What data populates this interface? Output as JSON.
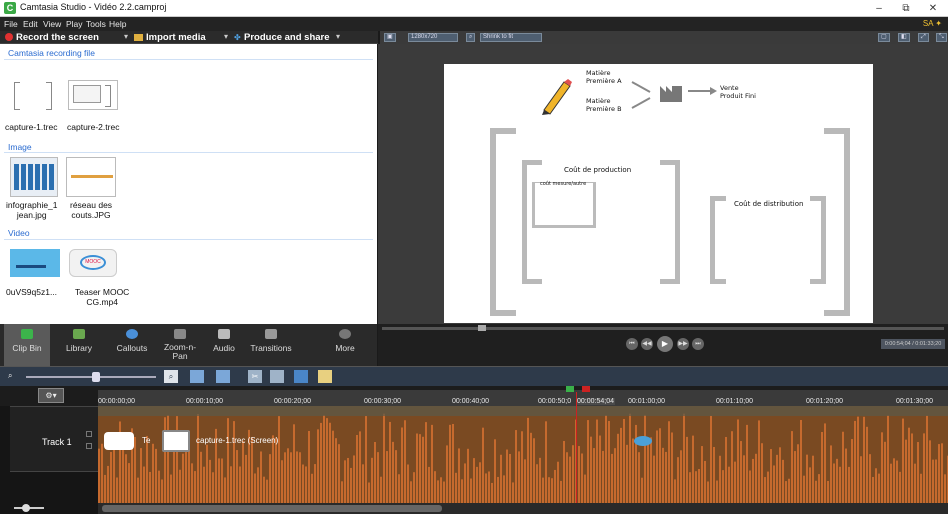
{
  "window": {
    "title": "Camtasia Studio - Vidéo 2.2.camproj",
    "app_icon": "C"
  },
  "menu": [
    "File",
    "Edit",
    "View",
    "Play",
    "Tools",
    "Help"
  ],
  "menu_badge": "SA ✦",
  "tasks": {
    "record": "Record the screen",
    "import": "Import media",
    "produce": "Produce and share"
  },
  "preview_toolbar": {
    "size_label": "1280x720",
    "shrink_label": "Shrink to fit"
  },
  "clip_bin": {
    "sections": {
      "recording": "Camtasia recording file",
      "image": "Image",
      "video": "Video"
    },
    "recordings": [
      "capture-1.trec",
      "capture-2.trec"
    ],
    "images": [
      {
        "line1": "infographie_1",
        "line2": "jean.jpg"
      },
      {
        "line1": "réseau des",
        "line2": "couts.JPG"
      }
    ],
    "videos": [
      {
        "line1": "0uVS9q5z1...",
        "line2": ""
      },
      {
        "line1": "Teaser MOOC",
        "line2": "CG.mp4"
      }
    ],
    "thumb_text": "MOOC"
  },
  "canvas": {
    "m1": "Matière",
    "m1b": "Première A",
    "m2": "Matière",
    "m2b": "Première B",
    "v1": "Vente",
    "v2": "Produit Fini",
    "cout_prod": "Coût de production",
    "small_box": "coût mesure/autre",
    "cout_dist": "Coût de distribution"
  },
  "tabs": [
    {
      "label": "Clip Bin",
      "icon": "clip-bin-icon",
      "color": "#3cb44b"
    },
    {
      "label": "Library",
      "icon": "library-icon",
      "color": "#6aa84f"
    },
    {
      "label": "Callouts",
      "icon": "callouts-icon",
      "color": "#4a90d9"
    },
    {
      "label": "Zoom-n-Pan",
      "icon": "zoom-n-pan-icon",
      "color": "#888888"
    },
    {
      "label": "Audio",
      "icon": "audio-icon",
      "color": "#bbbbbb"
    },
    {
      "label": "Transitions",
      "icon": "transitions-icon",
      "color": "#999999"
    },
    {
      "label": "More",
      "icon": "more-icon",
      "color": "#777777"
    }
  ],
  "playback": {
    "time": "0:00:54;04 / 0:01:33;20"
  },
  "timeline": {
    "ticks": [
      "00:00:00;00",
      "00:00:10;00",
      "00:00:20;00",
      "00:00:30;00",
      "00:00:40;00",
      "00:00:50;0",
      "00:00:54;04",
      "00:01:00;00",
      "00:01:10;00",
      "00:01:20;00",
      "00:01:30;00"
    ],
    "track_name": "Track 1",
    "clip_label": "capture-1.trec (Screen)",
    "clip_tag": "Te"
  },
  "colors": {
    "audio_wave": "#c66a2e",
    "playhead": "#cc2222",
    "accent": "#3aa845"
  }
}
